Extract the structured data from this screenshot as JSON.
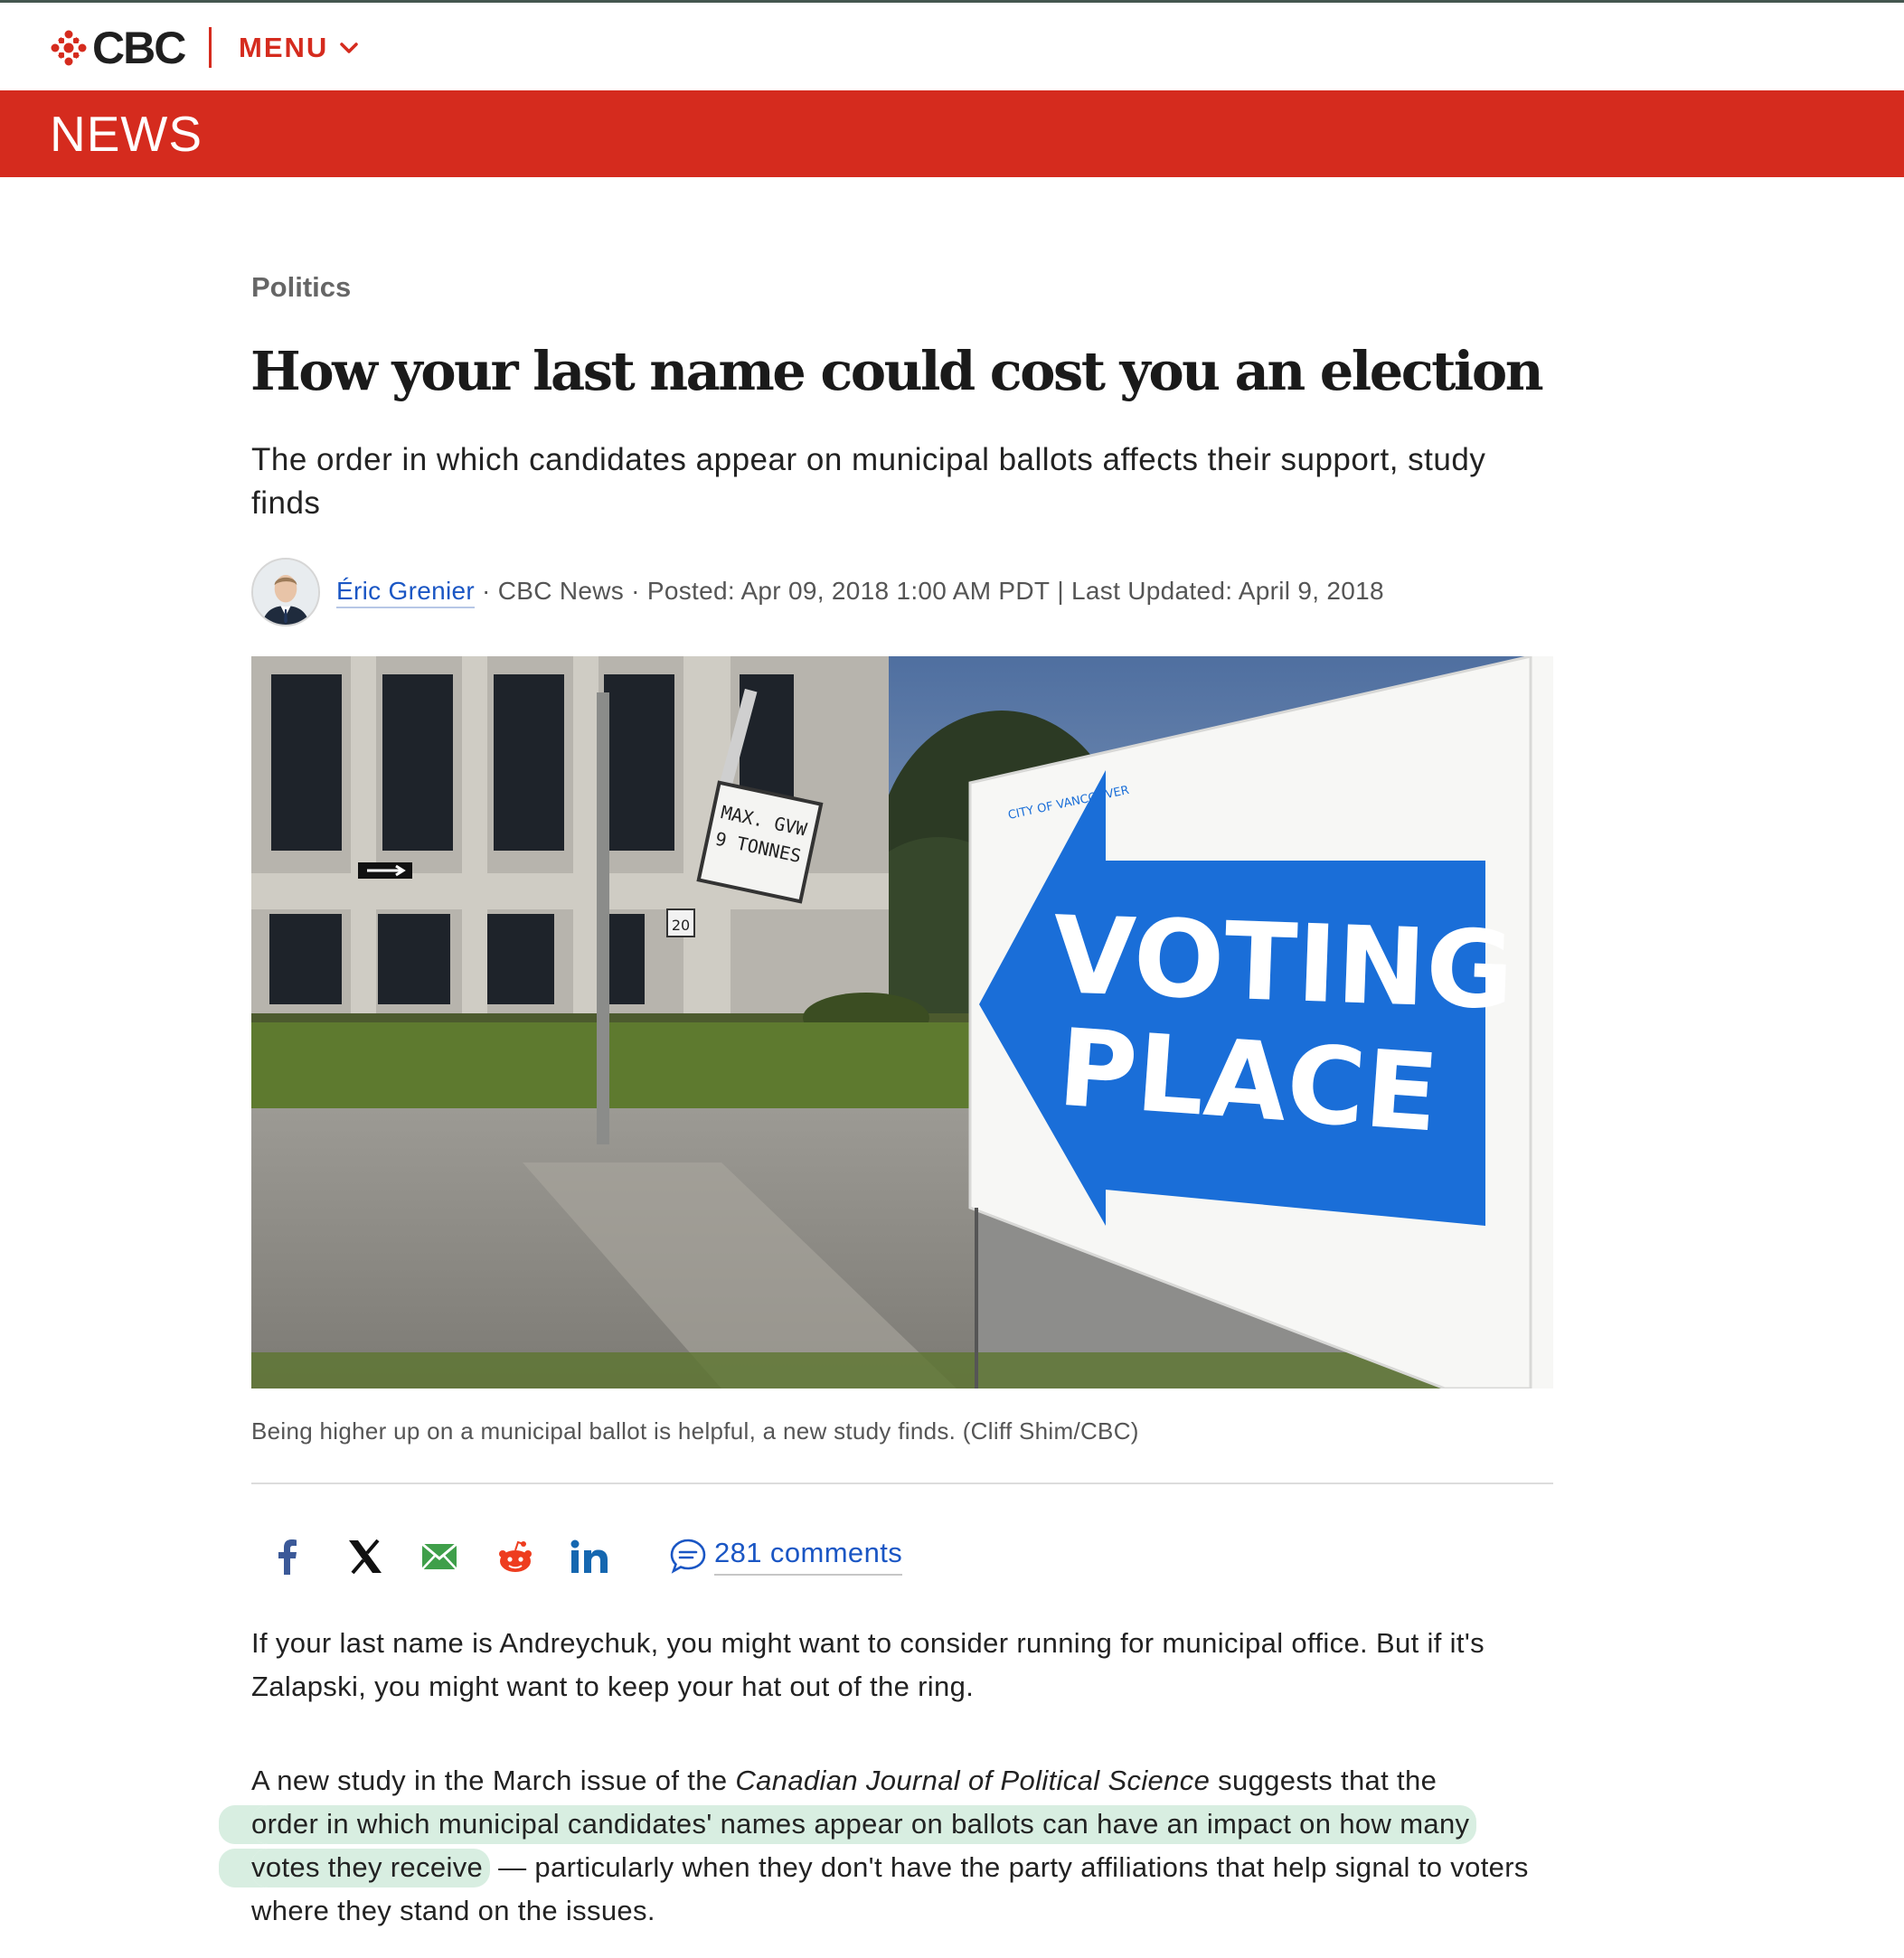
{
  "header": {
    "logo_text": "CBC",
    "menu_label": "MENU",
    "section_banner": "NEWS"
  },
  "article": {
    "section": "Politics",
    "headline": "How your last name could cost you an election",
    "deck": "The order in which candidates appear on municipal ballots affects their support, study finds",
    "byline": {
      "author": "Éric Grenier",
      "sep1": " · ",
      "outlet": "CBC News",
      "sep2": " · ",
      "posted": "Posted: Apr 09, 2018 1:00 AM PDT",
      "sep3": " | ",
      "updated": "Last Updated: April 9, 2018"
    },
    "photo": {
      "sign_top_small": "CITY OF VANCOUVER",
      "sign_line_1": "VOTING",
      "sign_line_2": "PLACE",
      "road_sign_line_1": "MAX. GVW",
      "road_sign_line_2": "9 TONNES",
      "speed_sign": "20"
    },
    "caption": "Being higher up on a municipal ballot is helpful, a new study finds. (Cliff Shim/CBC)",
    "share": {
      "icons": [
        "facebook-icon",
        "x-icon",
        "email-icon",
        "reddit-icon",
        "linkedin-icon"
      ],
      "comments": "281 comments"
    },
    "paragraph_1": "If your last name is Andreychuk, you might want to consider running for municipal office. But if it's Zalapski, you might want to keep your hat out of the ring.",
    "paragraph_2": {
      "part_1": "A new study in the March issue of the ",
      "journal": "Canadian Journal of Political Science",
      "part_2": " suggests that the ",
      "highlight_1": "order in which municipal candidates' names appear on ballots can have an impact on how many",
      "highlight_2": "votes they receive",
      "part_3": " — particularly when they don't have the party affiliations that help signal to voters where they stand on the issues."
    }
  },
  "colors": {
    "brand_red": "#d52b1e",
    "link_blue": "#1a56c4",
    "highlight_green": "#d8eee1",
    "sign_blue": "#1a6ed8"
  }
}
